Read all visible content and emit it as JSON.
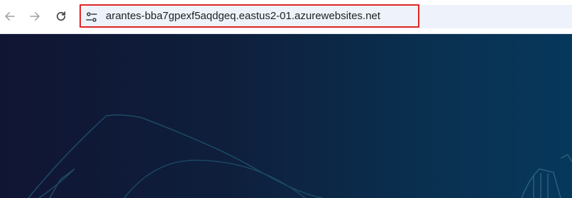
{
  "browser": {
    "address_bar": {
      "url": "arantes-bba7gpexf5aqdgeq.eastus2-01.azurewebsites.net"
    },
    "icons": {
      "back": "arrow-left-icon",
      "forward": "arrow-right-icon",
      "reload": "reload-icon",
      "site_info": "tune-icon"
    },
    "highlight_color": "#e02424"
  },
  "page": {
    "background_colors": [
      "#101533",
      "#06385c"
    ]
  }
}
